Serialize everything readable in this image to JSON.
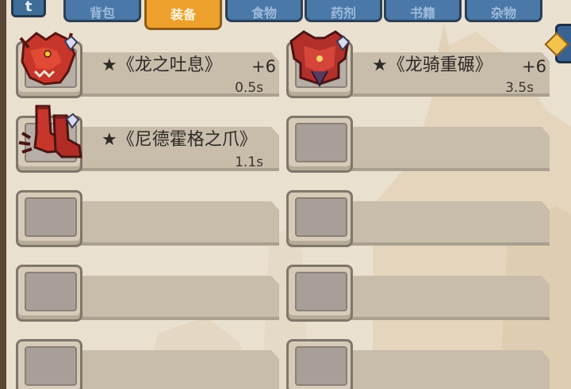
{
  "colors": {
    "tab_blue": "#4a78a8",
    "tab_active": "#eea02c",
    "plate": "#c8bdab",
    "text": "#2e2a26",
    "item_red": "#c7362b"
  },
  "top_bar": {
    "corner_label": "t",
    "tabs": [
      {
        "label": "背包",
        "active": false
      },
      {
        "label": "装备",
        "active": true
      },
      {
        "label": "食物",
        "active": false
      },
      {
        "label": "药剂",
        "active": false
      },
      {
        "label": "书籍",
        "active": false
      },
      {
        "label": "杂物",
        "active": false
      }
    ]
  },
  "equipment": [
    {
      "name": "★《龙之吐息》",
      "level": "+6",
      "cooldown": "0.5s",
      "icon": "dragon-head-icon"
    },
    {
      "name": "★《龙骑重碾》",
      "level": "+6",
      "cooldown": "3.5s",
      "icon": "dragon-armor-icon"
    },
    {
      "name": "★《尼德霍格之爪》",
      "level": "",
      "cooldown": "1.1s",
      "icon": "dragon-claw-boots-icon"
    },
    {
      "name": "",
      "level": "",
      "cooldown": "",
      "icon": ""
    },
    {
      "name": "",
      "level": "",
      "cooldown": "",
      "icon": ""
    },
    {
      "name": "",
      "level": "",
      "cooldown": "",
      "icon": ""
    },
    {
      "name": "",
      "level": "",
      "cooldown": "",
      "icon": ""
    },
    {
      "name": "",
      "level": "",
      "cooldown": "",
      "icon": ""
    },
    {
      "name": "",
      "level": "",
      "cooldown": "",
      "icon": ""
    },
    {
      "name": "",
      "level": "",
      "cooldown": "",
      "icon": ""
    }
  ]
}
